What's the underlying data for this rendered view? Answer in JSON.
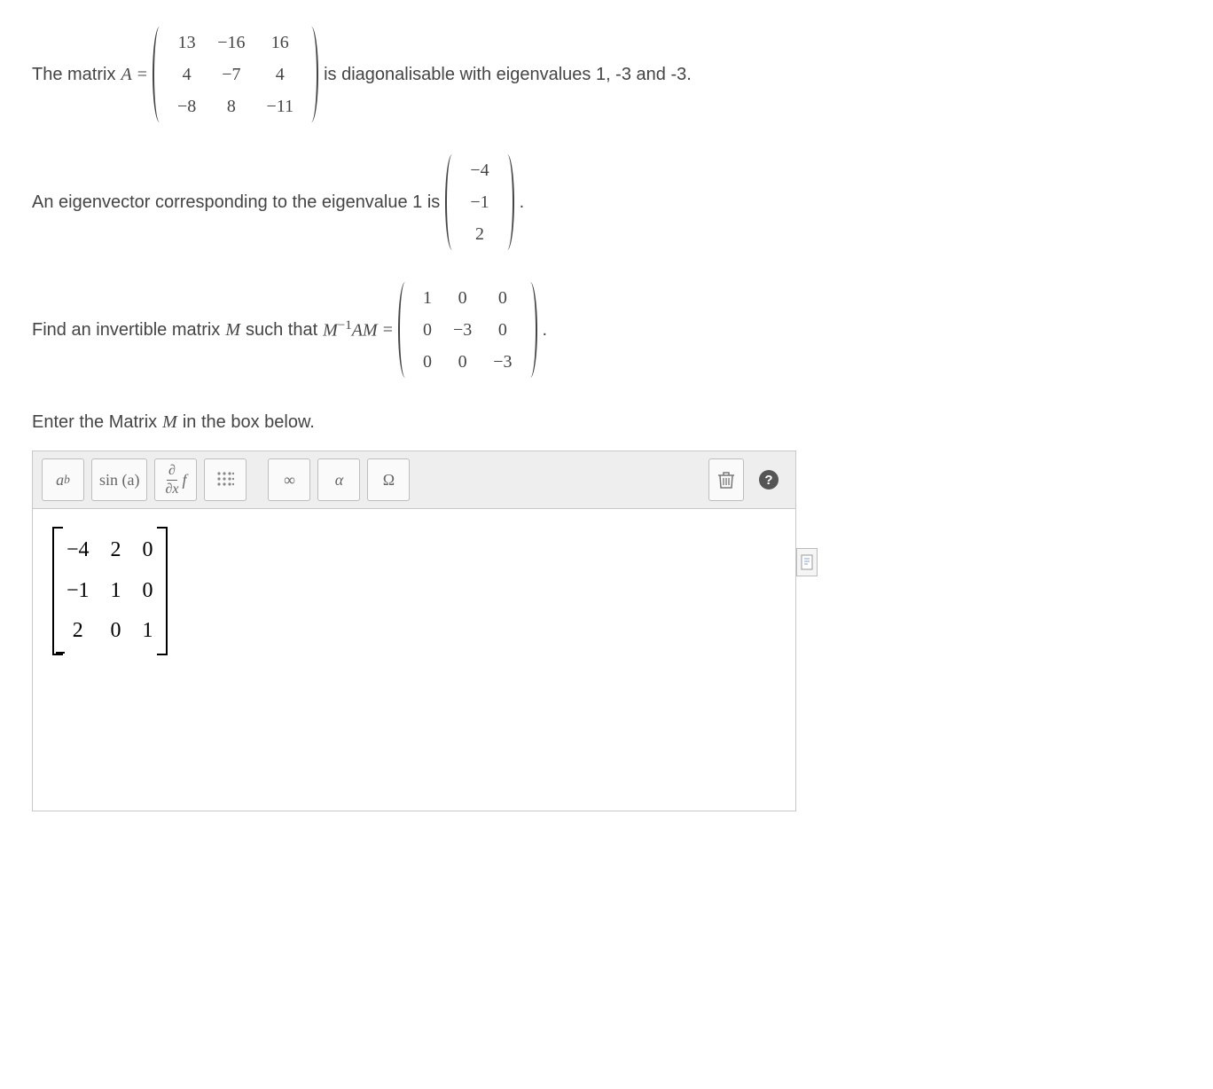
{
  "para1_pre": "The matrix ",
  "matAName": "A",
  "equals": " = ",
  "matrixA": [
    [
      "13",
      "−16",
      "16"
    ],
    [
      "4",
      "−7",
      "4"
    ],
    [
      "−8",
      "8",
      "−11"
    ]
  ],
  "para1_post": " is diagonalisable with eigenvalues 1, -3 and -3.",
  "para2_pre": "An eigenvector corresponding to the eigenvalue 1 is ",
  "eigvec": [
    [
      "−4"
    ],
    [
      "−1"
    ],
    [
      "2"
    ]
  ],
  "period": ".",
  "para3_pre": "Find an invertible matrix ",
  "MName": "M",
  "para3_mid": " such that ",
  "minv_am": "M",
  "minv_exp": "−1",
  "minv_tail": "AM",
  "diagMatrix": [
    [
      "1",
      "0",
      "0"
    ],
    [
      "0",
      "−3",
      "0"
    ],
    [
      "0",
      "0",
      "−3"
    ]
  ],
  "para4": "Enter the Matrix ",
  "para4_tail": "  in the box below.",
  "toolbar": {
    "ab": {
      "a": "a",
      "b": "b"
    },
    "sina": "sin (a)",
    "dx_num": "∂",
    "dx_den": "∂x",
    "dx_f": "f",
    "inf": "∞",
    "alpha": "α",
    "omega": "Ω"
  },
  "answerMatrix": [
    [
      "−4",
      "2",
      "0"
    ],
    [
      "−1",
      "1",
      "0"
    ],
    [
      "2",
      "0",
      "1"
    ]
  ]
}
